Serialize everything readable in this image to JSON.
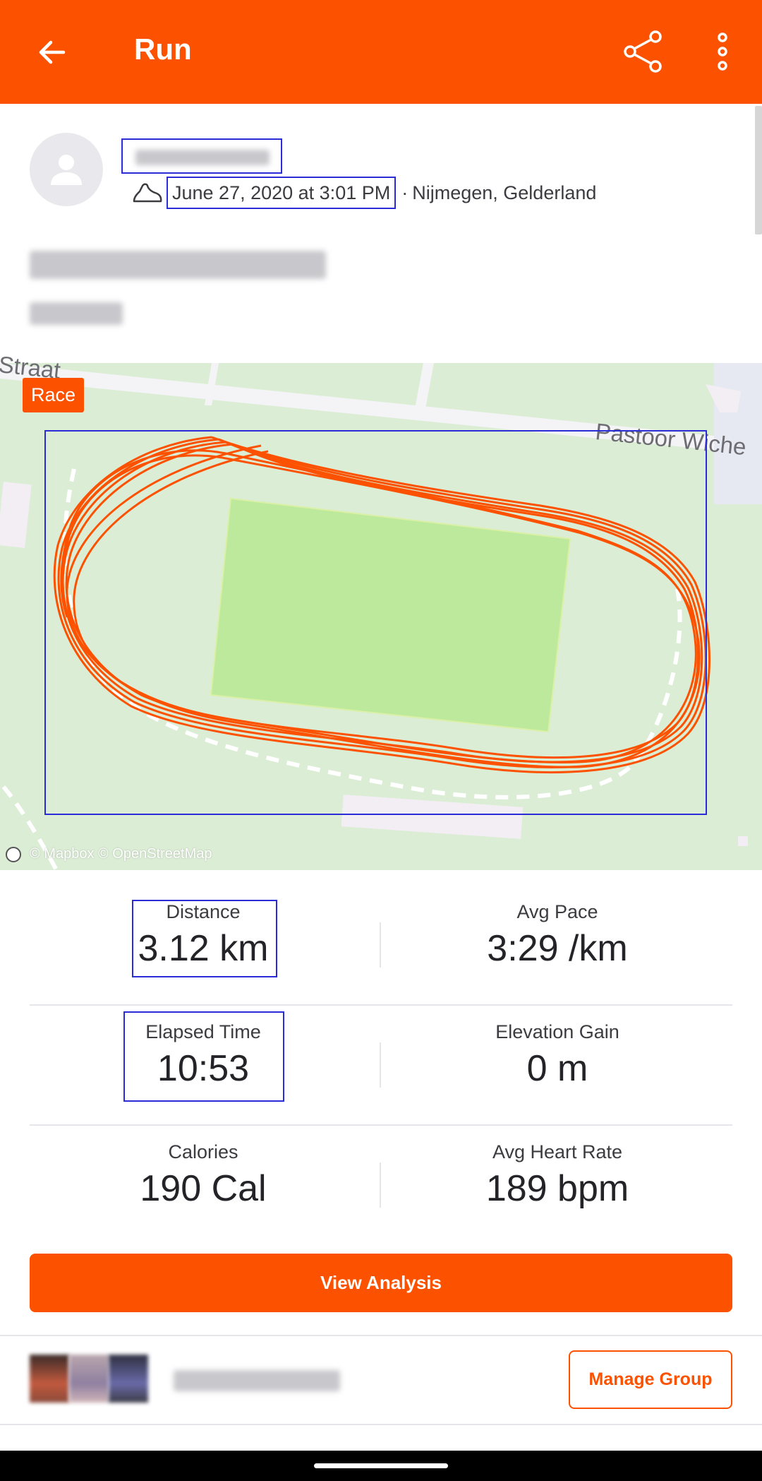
{
  "app_bar": {
    "title": "Run",
    "back_icon": "arrow-left-icon",
    "share_icon": "share-icon",
    "more_icon": "more-vertical-icon",
    "color": "#fc5200"
  },
  "header": {
    "activity_type_icon": "shoe-icon",
    "date": "June 27, 2020 at 3:01 PM",
    "location_separator": "·",
    "location": "Nijmegen, Gelderland"
  },
  "map": {
    "race_tag": "Race",
    "street_label": "Pastoor Wiche",
    "street_label_partial": "Straat",
    "attribution": "© Mapbox © OpenStreetMap",
    "route_color": "#fc5200"
  },
  "stats": [
    {
      "label": "Distance",
      "value": "3.12 km"
    },
    {
      "label": "Avg Pace",
      "value": "3:29 /km"
    },
    {
      "label": "Elapsed Time",
      "value": "10:53"
    },
    {
      "label": "Elevation Gain",
      "value": "0 m"
    },
    {
      "label": "Calories",
      "value": "190 Cal"
    },
    {
      "label": "Avg Heart Rate",
      "value": "189 bpm"
    }
  ],
  "actions": {
    "view_analysis": "View Analysis",
    "manage_group": "Manage Group"
  }
}
